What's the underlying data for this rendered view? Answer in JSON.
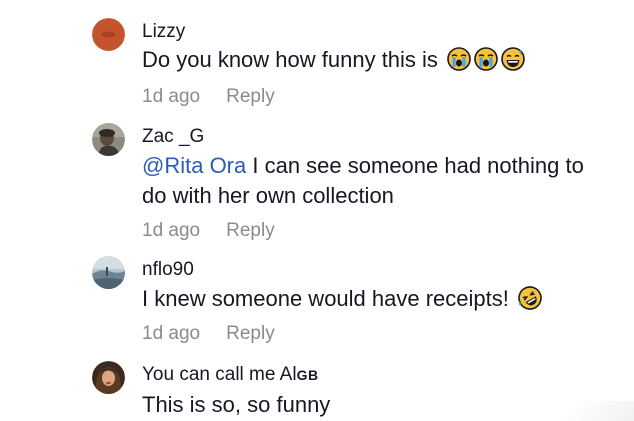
{
  "comments": [
    {
      "username": "Lizzy",
      "text": "Do you know how funny this is",
      "emojis": [
        "crying-face-icon",
        "crying-face-icon",
        "grinning-sweat-face-icon"
      ],
      "time": "1d ago",
      "reply_label": "Reply",
      "avatar_color": "#c4542e"
    },
    {
      "username": "Zac _G",
      "mention": "@Rita Ora",
      "text_line1": " I can see someone had nothing to",
      "text_line2": "do with her own collection",
      "time": "1d ago",
      "reply_label": "Reply",
      "avatar_color": "#4a4640"
    },
    {
      "username": "nflo90",
      "text": "I knew someone would have receipts!",
      "emojis": [
        "rolling-laughing-face-icon"
      ],
      "time": "1d ago",
      "reply_label": "Reply",
      "avatar_color": "#7f97a8"
    },
    {
      "username_main": "You can call me Al",
      "username_suffix": "GB",
      "text": "This is so, so funny",
      "avatar_color": "#6b4a30"
    }
  ],
  "colors": {
    "text": "#161823",
    "meta": "#8a8b91",
    "mention": "#2b5db8",
    "emoji_face": "#f7c23a"
  }
}
